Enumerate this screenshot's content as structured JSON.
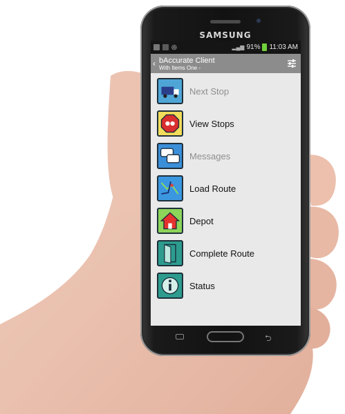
{
  "phone": {
    "brand": "SAMSUNG"
  },
  "statusbar": {
    "battery": "91%",
    "time": "11:03 AM"
  },
  "actionbar": {
    "title": "bAccurate Client",
    "subtitle": "With Items One -"
  },
  "menu": {
    "items": [
      {
        "label": "Next Stop",
        "icon": "truck-icon",
        "enabled": false
      },
      {
        "label": "View Stops",
        "icon": "stop-sign-icon",
        "enabled": true
      },
      {
        "label": "Messages",
        "icon": "chat-bubbles-icon",
        "enabled": false
      },
      {
        "label": "Load Route",
        "icon": "route-map-icon",
        "enabled": true
      },
      {
        "label": "Depot",
        "icon": "house-icon",
        "enabled": true
      },
      {
        "label": "Complete Route",
        "icon": "door-icon",
        "enabled": true
      },
      {
        "label": "Status",
        "icon": "info-icon",
        "enabled": true
      }
    ]
  },
  "colors": {
    "actionbar": "#8c8c8c",
    "screen_bg": "#e9e9e9",
    "battery": "#6fd13c"
  }
}
